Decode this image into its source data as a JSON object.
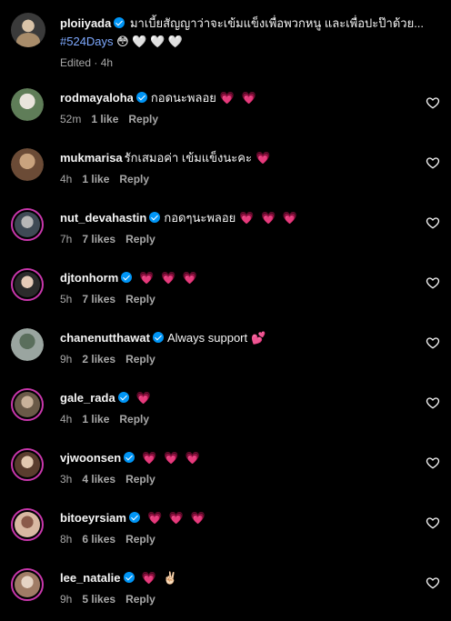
{
  "caption": {
    "username": "ploiiyada",
    "text": "มาเบี้ยสัญญาว่าจะเข้มแข็งเพื่อพวกหนู และเพื่อปะป๊าด้วย...",
    "hashtag": "#524Days",
    "emojis": "😳 🤍 🤍 🤍",
    "edited": "Edited",
    "time": "4h"
  },
  "comments": [
    {
      "username": "rodmayaloha",
      "verified": true,
      "text": "กอดนะพลอย",
      "hearts": "💗 💗",
      "time": "52m",
      "likes": "1 like",
      "reply": "Reply",
      "ring": false,
      "avatar_colors": [
        "#e9e4dc",
        "#5f7d58"
      ]
    },
    {
      "username": "mukmarisa",
      "verified": false,
      "text": "รักเสมอค่า เข้มแข็งนะคะ",
      "hearts": "💗",
      "time": "4h",
      "likes": "1 like",
      "reply": "Reply",
      "ring": false,
      "avatar_colors": [
        "#c9a37e",
        "#6b4b36"
      ]
    },
    {
      "username": "nut_devahastin",
      "verified": true,
      "text": "กอดๆนะพลอย",
      "hearts": "💗 💗 💗",
      "time": "7h",
      "likes": "7 likes",
      "reply": "Reply",
      "ring": true,
      "avatar_colors": [
        "#b7b7b7",
        "#3f4a55"
      ]
    },
    {
      "username": "djtonhorm",
      "verified": true,
      "text": "",
      "hearts": "💗 💗 💗",
      "time": "5h",
      "likes": "7 likes",
      "reply": "Reply",
      "ring": true,
      "avatar_colors": [
        "#e5cbb8",
        "#2b2b2b"
      ]
    },
    {
      "username": "chanenutthawat",
      "verified": true,
      "text": "Always support",
      "hearts": "💕",
      "time": "9h",
      "likes": "2 likes",
      "reply": "Reply",
      "ring": false,
      "avatar_colors": [
        "#5a6e5c",
        "#9aa5a0"
      ]
    },
    {
      "username": "gale_rada",
      "verified": true,
      "text": "",
      "hearts": "💗",
      "time": "4h",
      "likes": "1 like",
      "reply": "Reply",
      "ring": true,
      "avatar_colors": [
        "#c9b29a",
        "#6a5a48"
      ]
    },
    {
      "username": "vjwoonsen",
      "verified": true,
      "text": "",
      "hearts": "💗 💗 💗",
      "time": "3h",
      "likes": "4 likes",
      "reply": "Reply",
      "ring": true,
      "avatar_colors": [
        "#e2c8b0",
        "#5a3d2e"
      ]
    },
    {
      "username": "bitoeyrsiam",
      "verified": true,
      "text": "",
      "hearts": "💗 💗 💗",
      "time": "8h",
      "likes": "6 likes",
      "reply": "Reply",
      "ring": true,
      "avatar_colors": [
        "#8a5a4a",
        "#d9b9a3"
      ]
    },
    {
      "username": "lee_natalie",
      "verified": true,
      "text": "",
      "hearts": "💗 ✌🏻",
      "time": "9h",
      "likes": "5 likes",
      "reply": "Reply",
      "ring": true,
      "avatar_colors": [
        "#e6d3c4",
        "#a07c66"
      ]
    }
  ]
}
